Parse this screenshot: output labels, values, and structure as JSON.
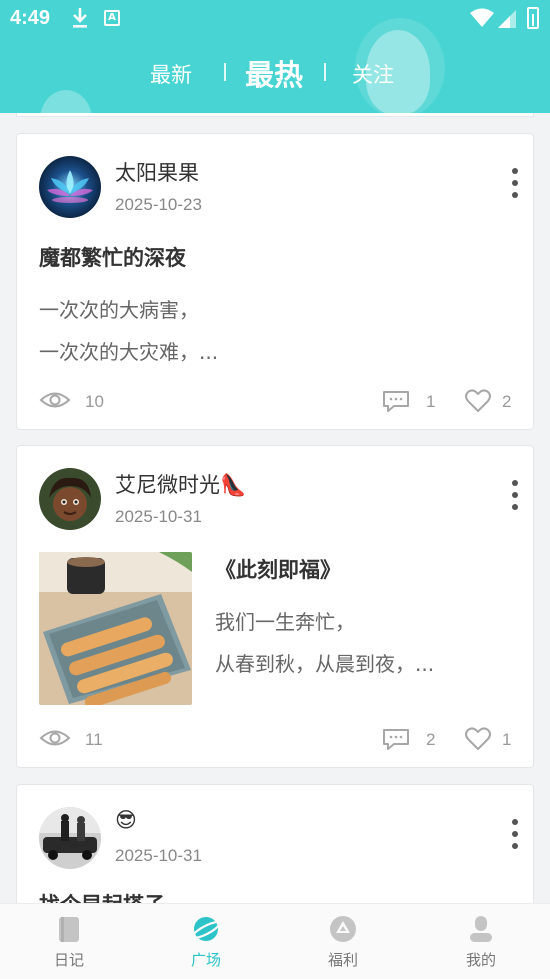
{
  "status_bar": {
    "time": "4:49",
    "badge": "A"
  },
  "tabs": {
    "latest": "最新",
    "hottest": "最热",
    "following": "关注"
  },
  "posts": [
    {
      "author": "太阳果果",
      "date": "2025-10-23",
      "title": "魔都繁忙的深夜",
      "excerpt_line1": "一次次的大病害，",
      "excerpt_line2": "一次次的大灾难，...",
      "views": "10",
      "comments": "1",
      "likes": "2"
    },
    {
      "author": "艾尼微时光👠",
      "date": "2025-10-31",
      "title": "《此刻即福》",
      "excerpt_line1": "我们一生奔忙，",
      "excerpt_line2": "从春到秋，从晨到夜，...",
      "views": "11",
      "comments": "2",
      "likes": "1"
    },
    {
      "author": "😎",
      "date": "2025-10-31",
      "title": "找个早起搭子"
    }
  ],
  "bottom_nav": [
    {
      "label": "日记",
      "icon": "diary-icon"
    },
    {
      "label": "广场",
      "icon": "planet-icon"
    },
    {
      "label": "福利",
      "icon": "welfare-icon"
    },
    {
      "label": "我的",
      "icon": "profile-icon"
    }
  ],
  "colors": {
    "header": "#48d4d3",
    "nav_active": "#2cc3c9"
  }
}
